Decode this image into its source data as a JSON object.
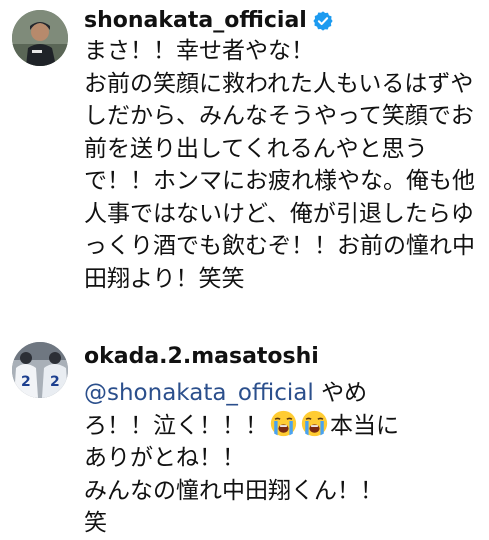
{
  "comments": [
    {
      "username": "shonakata_official",
      "verified": true,
      "text": "まさ！！幸せ者やな！\nお前の笑顔に救われた人もいるはずやしだから、みんなそうやって笑顔でお前を送り出してくれるんやと思うで！！ホンマにお疲れ様やな。俺も他人事ではないけど、俺が引退したらゆっくり酒でも飲むぞ！！お前の憧れ中田翔より！笑笑"
    },
    {
      "username": "okada.2.masatoshi",
      "verified": false,
      "mention": "@shonakata_official",
      "text_a": " やめろ！！泣く！！！",
      "emoji": "loudly-crying-face-emoji",
      "text_b": "本当にありがとね！！\nみんなの憧れ中田翔くん！！\n笑"
    }
  ],
  "colors": {
    "mention": "#2b4f8c",
    "verified_badge": "#1d9bf0"
  }
}
